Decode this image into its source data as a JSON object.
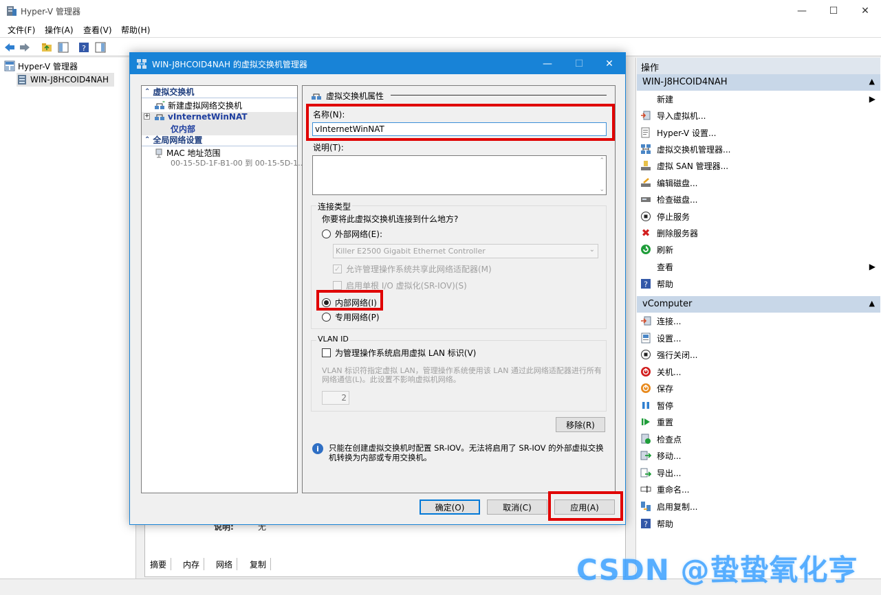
{
  "window": {
    "title": "Hyper-V 管理器",
    "controls": {
      "minimize": "—",
      "maximize": "☐",
      "close": "✕"
    }
  },
  "menu": [
    "文件(F)",
    "操作(A)",
    "查看(V)",
    "帮助(H)"
  ],
  "tree": {
    "root": "Hyper-V 管理器",
    "server": "WIN-J8HCOID4NAH"
  },
  "actions": {
    "header": "操作",
    "server_section": "WIN-J8HCOID4NAH",
    "server_items": [
      "新建",
      "导入虚拟机...",
      "Hyper-V 设置...",
      "虚拟交换机管理器...",
      "虚拟 SAN 管理器...",
      "编辑磁盘...",
      "检查磁盘...",
      "停止服务",
      "删除服务器",
      "刷新",
      "查看",
      "帮助"
    ],
    "vm_section": "vComputer",
    "vm_items": [
      "连接...",
      "设置...",
      "强行关闭...",
      "关机...",
      "保存",
      "暂停",
      "重置",
      "检查点",
      "移动...",
      "导出...",
      "重命名...",
      "启用复制...",
      "帮助"
    ]
  },
  "center": {
    "desc_label": "说明:",
    "desc_value": "无",
    "tabs": [
      "摘要",
      "内存",
      "网络",
      "复制"
    ]
  },
  "dialog": {
    "title": "WIN-J8HCOID4NAH 的虚拟交换机管理器",
    "left": {
      "group1": "虚拟交换机",
      "new_switch": "新建虚拟网络交换机",
      "switch_name": "vInternetWinNAT",
      "switch_type": "仅内部",
      "group2": "全局网络设置",
      "mac_label": "MAC 地址范围",
      "mac_value": "00-15-5D-1F-B1-00 到 00-15-5D-1..."
    },
    "props": {
      "section_title": "虚拟交换机属性",
      "name_label": "名称(N):",
      "name_value": "vInternetWinNAT",
      "desc_label": "说明(T):",
      "conn_group": "连接类型",
      "conn_question": "你要将此虚拟交换机连接到什么地方?",
      "external": "外部网络(E):",
      "adapter": "Killer E2500 Gigabit Ethernet Controller",
      "allow_share": "允许管理操作系统共享此网络适配器(M)",
      "sriov": "启用单根 I/O 虚拟化(SR-IOV)(S)",
      "internal": "内部网络(I)",
      "private": "专用网络(P)",
      "vlan_group": "VLAN ID",
      "vlan_check": "为管理操作系统启用虚拟 LAN 标识(V)",
      "vlan_desc": "VLAN 标识符指定虚拟 LAN，管理操作系统使用该 LAN 通过此网络适配器进行所有网络通信(L)。此设置不影响虚拟机网络。",
      "vlan_value": "2",
      "remove": "移除(R)",
      "info": "只能在创建虚拟交换机时配置 SR-IOV。无法将启用了 SR-IOV 的外部虚拟交换机转换为内部或专用交换机。"
    },
    "buttons": {
      "ok": "确定(O)",
      "cancel": "取消(C)",
      "apply": "应用(A)"
    }
  },
  "watermark": "CSDN @蛰蛰氧化亨",
  "colors": {
    "accent": "#1883d7",
    "highlight": "#e00000"
  }
}
